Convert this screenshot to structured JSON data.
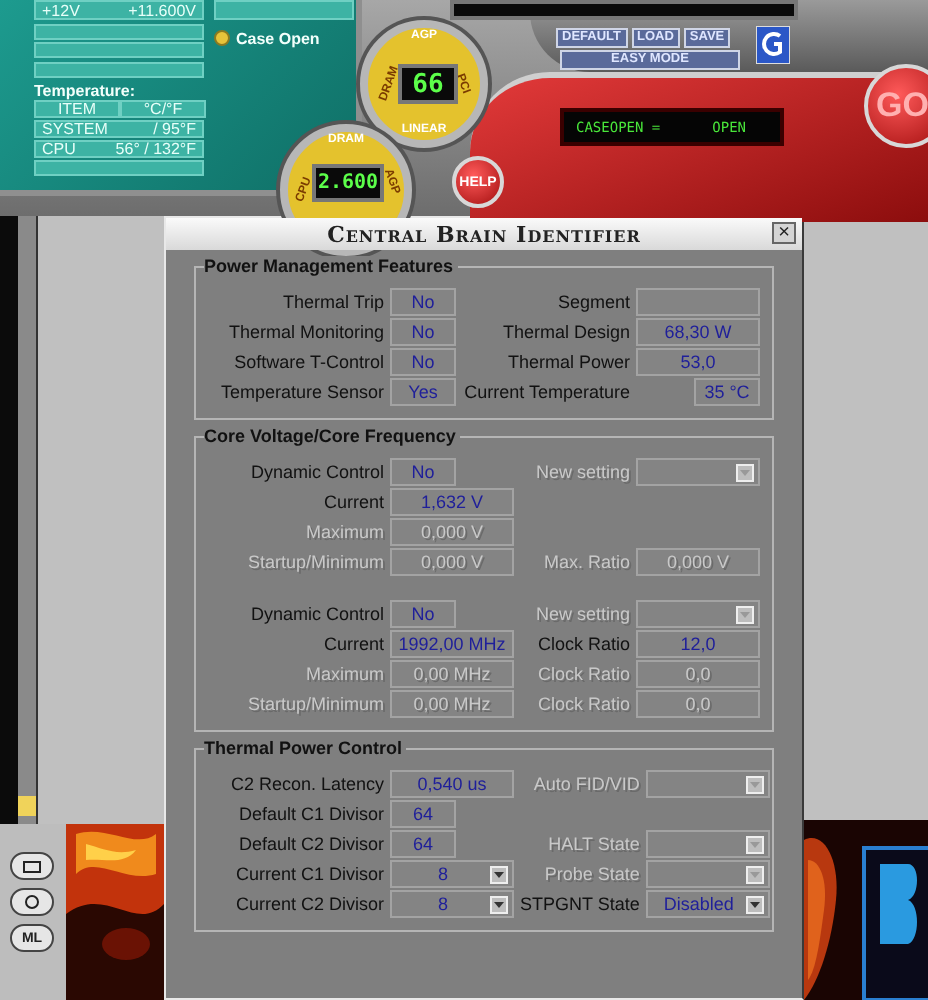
{
  "hardware_monitor": {
    "voltage": {
      "label": "+12V",
      "value": "+11.600V"
    },
    "case_open": {
      "label": "Case Open",
      "checked": true
    },
    "temperature": {
      "title": "Temperature:",
      "columns": [
        "ITEM",
        "°C/°F"
      ],
      "rows": [
        {
          "item": "SYSTEM",
          "reading": "/ 95°F"
        },
        {
          "item": "CPU",
          "reading": "56° / 132°F"
        }
      ]
    }
  },
  "gauges": [
    {
      "top": "AGP",
      "left": "DRAM",
      "right": "PCI",
      "bottom": "LINEAR",
      "reading": "66"
    },
    {
      "top": "DRAM",
      "left": "CPU",
      "right": "AGP",
      "reading": "2.600"
    }
  ],
  "toolbar": {
    "buttons": [
      "DEFAULT",
      "LOAD",
      "SAVE"
    ],
    "mode": "EASY MODE"
  },
  "status_display": {
    "label": "CASEOPEN =",
    "value": "OPEN"
  },
  "help_button": "HELP",
  "go_button": "GO",
  "dialog": {
    "title": "Central Brain Identifier",
    "close": "×",
    "sections": [
      {
        "title": "Power Management Features",
        "blocks": [
          {
            "rows": [
              {
                "left": {
                  "label": "Thermal Trip",
                  "value": "No",
                  "kind": "short",
                  "disabled": false
                },
                "right": {
                  "label": "Segment",
                  "kind": "long",
                  "disabled": false
                }
              },
              {
                "left": {
                  "label": "Thermal Monitoring",
                  "value": "No",
                  "kind": "short",
                  "disabled": false
                },
                "right": {
                  "label": "Thermal Design",
                  "value": "68,30 W",
                  "kind": "long",
                  "disabled": false
                }
              },
              {
                "left": {
                  "label": "Software T-Control",
                  "value": "No",
                  "kind": "short",
                  "disabled": false
                },
                "right": {
                  "label": "Thermal Power",
                  "value": "53,0",
                  "kind": "long",
                  "disabled": false
                }
              },
              {
                "left": {
                  "label": "Temperature Sensor",
                  "value": "Yes",
                  "kind": "short",
                  "disabled": false
                },
                "right": {
                  "label": "Current Temperature",
                  "value": "35 °C",
                  "kind": "short",
                  "disabled": false
                }
              }
            ]
          }
        ]
      },
      {
        "title": "Core Voltage/Core Frequency",
        "blocks": [
          {
            "rows": [
              {
                "left": {
                  "label": "Dynamic Control",
                  "value": "No",
                  "kind": "short",
                  "disabled": false
                },
                "right": {
                  "label": "New setting",
                  "kind": "dropdown",
                  "disabled": true
                }
              },
              {
                "left": {
                  "label": "Current",
                  "value": "1,632 V",
                  "kind": "long",
                  "disabled": false
                }
              },
              {
                "left": {
                  "label": "Maximum",
                  "value": "0,000 V",
                  "kind": "long",
                  "disabled": true
                }
              },
              {
                "left": {
                  "label": "Startup/Minimum",
                  "value": "0,000 V",
                  "kind": "long",
                  "disabled": true
                },
                "right": {
                  "label": "Max. Ratio",
                  "value": "0,000 V",
                  "kind": "long",
                  "disabled": true
                }
              }
            ]
          },
          {
            "rows": [
              {
                "left": {
                  "label": "Dynamic Control",
                  "value": "No",
                  "kind": "short",
                  "disabled": false
                },
                "right": {
                  "label": "New setting",
                  "kind": "dropdown",
                  "disabled": true
                }
              },
              {
                "left": {
                  "label": "Current",
                  "value": "1992,00 MHz",
                  "kind": "long",
                  "disabled": false
                },
                "right": {
                  "label": "Clock Ratio",
                  "value": "12,0",
                  "kind": "long",
                  "disabled": false
                }
              },
              {
                "left": {
                  "label": "Maximum",
                  "value": "0,00 MHz",
                  "kind": "long",
                  "disabled": true
                },
                "right": {
                  "label": "Clock Ratio",
                  "value": "0,0",
                  "kind": "long",
                  "disabled": true
                }
              },
              {
                "left": {
                  "label": "Startup/Minimum",
                  "value": "0,00 MHz",
                  "kind": "long",
                  "disabled": true
                },
                "right": {
                  "label": "Clock Ratio",
                  "value": "0,0",
                  "kind": "long",
                  "disabled": true
                }
              }
            ]
          }
        ]
      },
      {
        "title": "Thermal Power Control",
        "blocks": [
          {
            "rows": [
              {
                "left": {
                  "label": "C2 Recon. Latency",
                  "value": "0,540 us",
                  "kind": "long",
                  "disabled": false
                },
                "right": {
                  "label": "Auto FID/VID",
                  "kind": "dropdown",
                  "disabled": true
                }
              },
              {
                "left": {
                  "label": "Default C1 Divisor",
                  "value": "64",
                  "kind": "short",
                  "disabled": false
                }
              },
              {
                "left": {
                  "label": "Default C2 Divisor",
                  "value": "64",
                  "kind": "short",
                  "disabled": false
                },
                "right": {
                  "label": "HALT State",
                  "kind": "dropdown",
                  "disabled": true
                }
              },
              {
                "left": {
                  "label": "Current C1 Divisor",
                  "value": "8",
                  "kind": "dropdown",
                  "disabled": false
                },
                "right": {
                  "label": "Probe State",
                  "kind": "dropdown",
                  "disabled": true
                }
              },
              {
                "left": {
                  "label": "Current C2 Divisor",
                  "value": "8",
                  "kind": "dropdown",
                  "disabled": false
                },
                "right": {
                  "label": "STPGNT State",
                  "value": "Disabled",
                  "kind": "dropdown",
                  "disabled": false
                }
              }
            ]
          }
        ]
      }
    ]
  },
  "dock": {
    "label": "ML"
  }
}
